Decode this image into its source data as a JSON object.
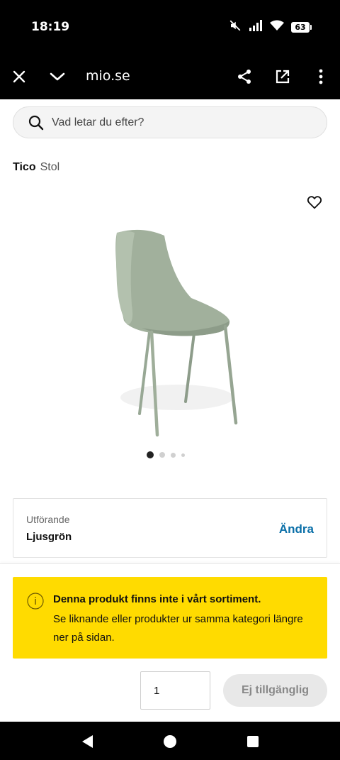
{
  "status_bar": {
    "time": "18:19",
    "battery": "63",
    "icons": [
      "mute-icon",
      "signal-icon",
      "wifi-icon",
      "battery-icon"
    ]
  },
  "browser": {
    "url": "mio.se",
    "icons": [
      "close-icon",
      "chevron-down-icon",
      "share-icon",
      "open-external-icon",
      "more-vert-icon"
    ]
  },
  "search": {
    "placeholder": "Vad letar du efter?"
  },
  "product": {
    "name": "Tico",
    "type": "Stol",
    "image_color": "#9fae9a",
    "carousel": {
      "count": 4,
      "active": 0
    }
  },
  "variant": {
    "label": "Utförande",
    "value": "Ljusgrön",
    "change_label": "Ändra"
  },
  "notice": {
    "title": "Denna produkt finns inte i vårt sortiment.",
    "body": "Se liknande eller produkter ur samma kategori längre ner på sidan.",
    "background": "#ffdb00"
  },
  "purchase": {
    "quantity": "1",
    "button_label": "Ej tillgänglig"
  },
  "colors": {
    "link": "#0a6fa8",
    "notice": "#ffdb00"
  }
}
